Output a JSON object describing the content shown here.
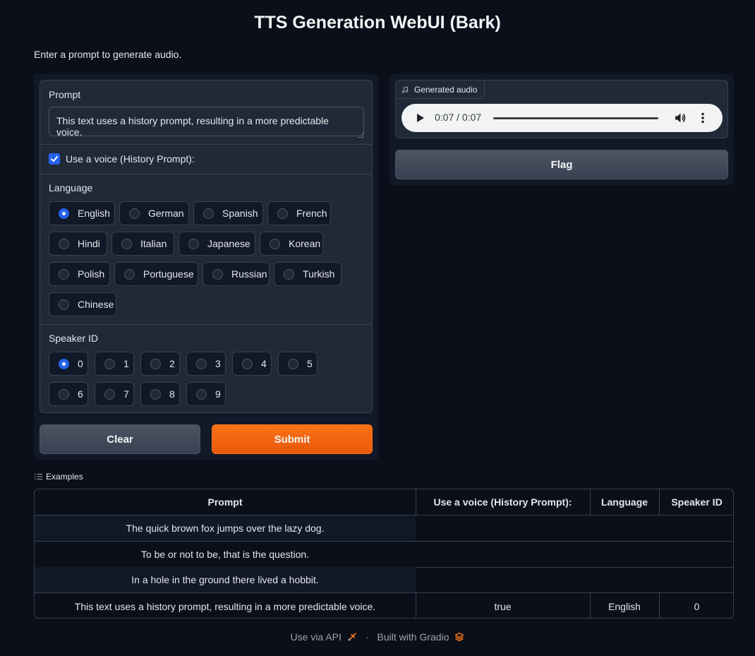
{
  "app": {
    "title": "TTS Generation WebUI (Bark)",
    "description": "Enter a prompt to generate audio."
  },
  "form": {
    "prompt_label": "Prompt",
    "prompt_value": "This text uses a history prompt, resulting in a more predictable voice.",
    "use_voice_label": "Use a voice (History Prompt):",
    "use_voice_checked": true,
    "language_label": "Language",
    "languages": [
      "English",
      "German",
      "Spanish",
      "French",
      "Hindi",
      "Italian",
      "Japanese",
      "Korean",
      "Polish",
      "Portuguese",
      "Russian",
      "Turkish",
      "Chinese"
    ],
    "language_selected": "English",
    "speaker_label": "Speaker ID",
    "speakers": [
      "0",
      "1",
      "2",
      "3",
      "4",
      "5",
      "6",
      "7",
      "8",
      "9"
    ],
    "speaker_selected": "0",
    "clear_label": "Clear",
    "submit_label": "Submit"
  },
  "output": {
    "audio_label": "Generated audio",
    "time_display": "0:07 / 0:07",
    "progress": 1.0,
    "flag_label": "Flag"
  },
  "examples": {
    "label": "Examples",
    "headers": [
      "Prompt",
      "Use a voice (History Prompt):",
      "Language",
      "Speaker ID"
    ],
    "rows": [
      [
        "The quick brown fox jumps over the lazy dog.",
        "",
        "",
        ""
      ],
      [
        "To be or not to be, that is the question.",
        "",
        "",
        ""
      ],
      [
        "In a hole in the ground there lived a hobbit.",
        "",
        "",
        ""
      ],
      [
        "This text uses a history prompt, resulting in a more predictable voice.",
        "true",
        "English",
        "0"
      ]
    ]
  },
  "footer": {
    "api_label": "Use via API",
    "separator": "·",
    "built_label": "Built with Gradio"
  },
  "colors": {
    "background": "#0b0f19",
    "panel": "#1f2937",
    "accent": "#2563eb",
    "primary": "#f97316"
  }
}
